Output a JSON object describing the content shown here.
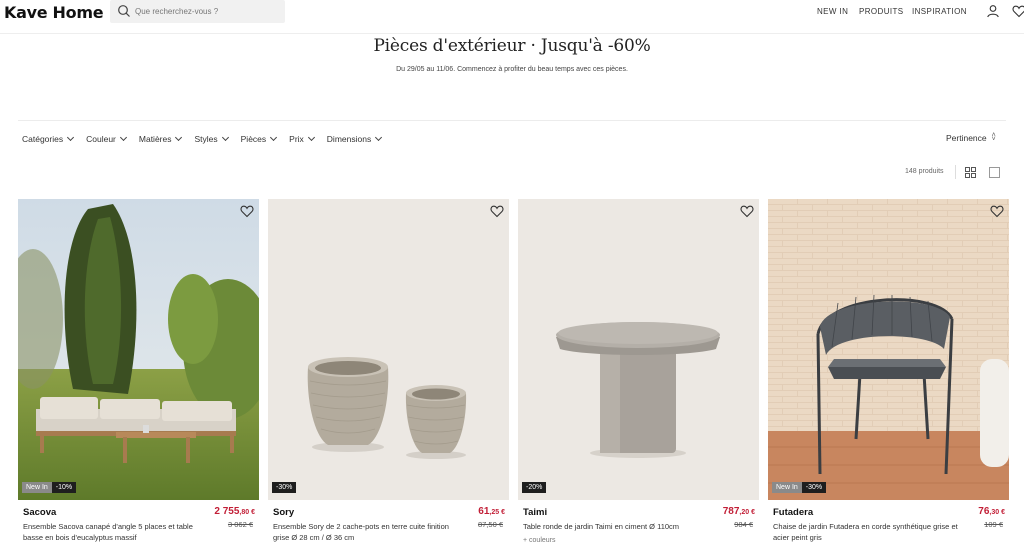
{
  "header": {
    "logo": "Kave Home",
    "search_placeholder": "Que recherchez-vous ?",
    "nav": [
      "NEW IN",
      "PRODUITS",
      "INSPIRATION"
    ]
  },
  "hero": {
    "title": "Pièces d'extérieur · Jusqu'à -60%",
    "subtitle": "Du 29/05 au 11/06. Commencez à profiter du beau temps avec ces pièces."
  },
  "filters": [
    "Catégories",
    "Couleur",
    "Matières",
    "Styles",
    "Pièces",
    "Prix",
    "Dimensions"
  ],
  "sort": {
    "label": "Pertinence"
  },
  "results": {
    "count": "148 produits"
  },
  "products": [
    {
      "name": "Sacova",
      "description": "Ensemble Sacova canapé d'angle 5 places et table basse en bois d'eucalyptus massif",
      "price_main": "2 755",
      "price_cents": ",80 €",
      "old_price": "3 062 €",
      "badge_new": "New In",
      "badge_discount": "-10%"
    },
    {
      "name": "Sory",
      "description": "Ensemble Sory de 2 cache-pots en terre cuite finition grise Ø 28 cm / Ø 36 cm",
      "price_main": "61",
      "price_cents": ",25 €",
      "old_price": "87,50 €",
      "badge_discount": "-30%"
    },
    {
      "name": "Taimi",
      "description": "Table ronde de jardin Taimi en ciment Ø 110cm",
      "price_main": "787",
      "price_cents": ",20 €",
      "old_price": "984 €",
      "badge_discount": "-20%",
      "colors_link": "+ couleurs"
    },
    {
      "name": "Futadera",
      "description": "Chaise de jardin Futadera en corde synthétique grise et acier peint gris",
      "price_main": "76",
      "price_cents": ",30 €",
      "old_price": "109 €",
      "badge_new": "New In",
      "badge_discount": "-30%"
    }
  ],
  "colors": {
    "price": "#c21e36",
    "badge_dark": "#1e1e1e",
    "badge_new": "#8a8a8a"
  },
  "icons": [
    "search-icon",
    "user-icon",
    "heart-icon",
    "grid-view-icon",
    "single-view-icon"
  ]
}
